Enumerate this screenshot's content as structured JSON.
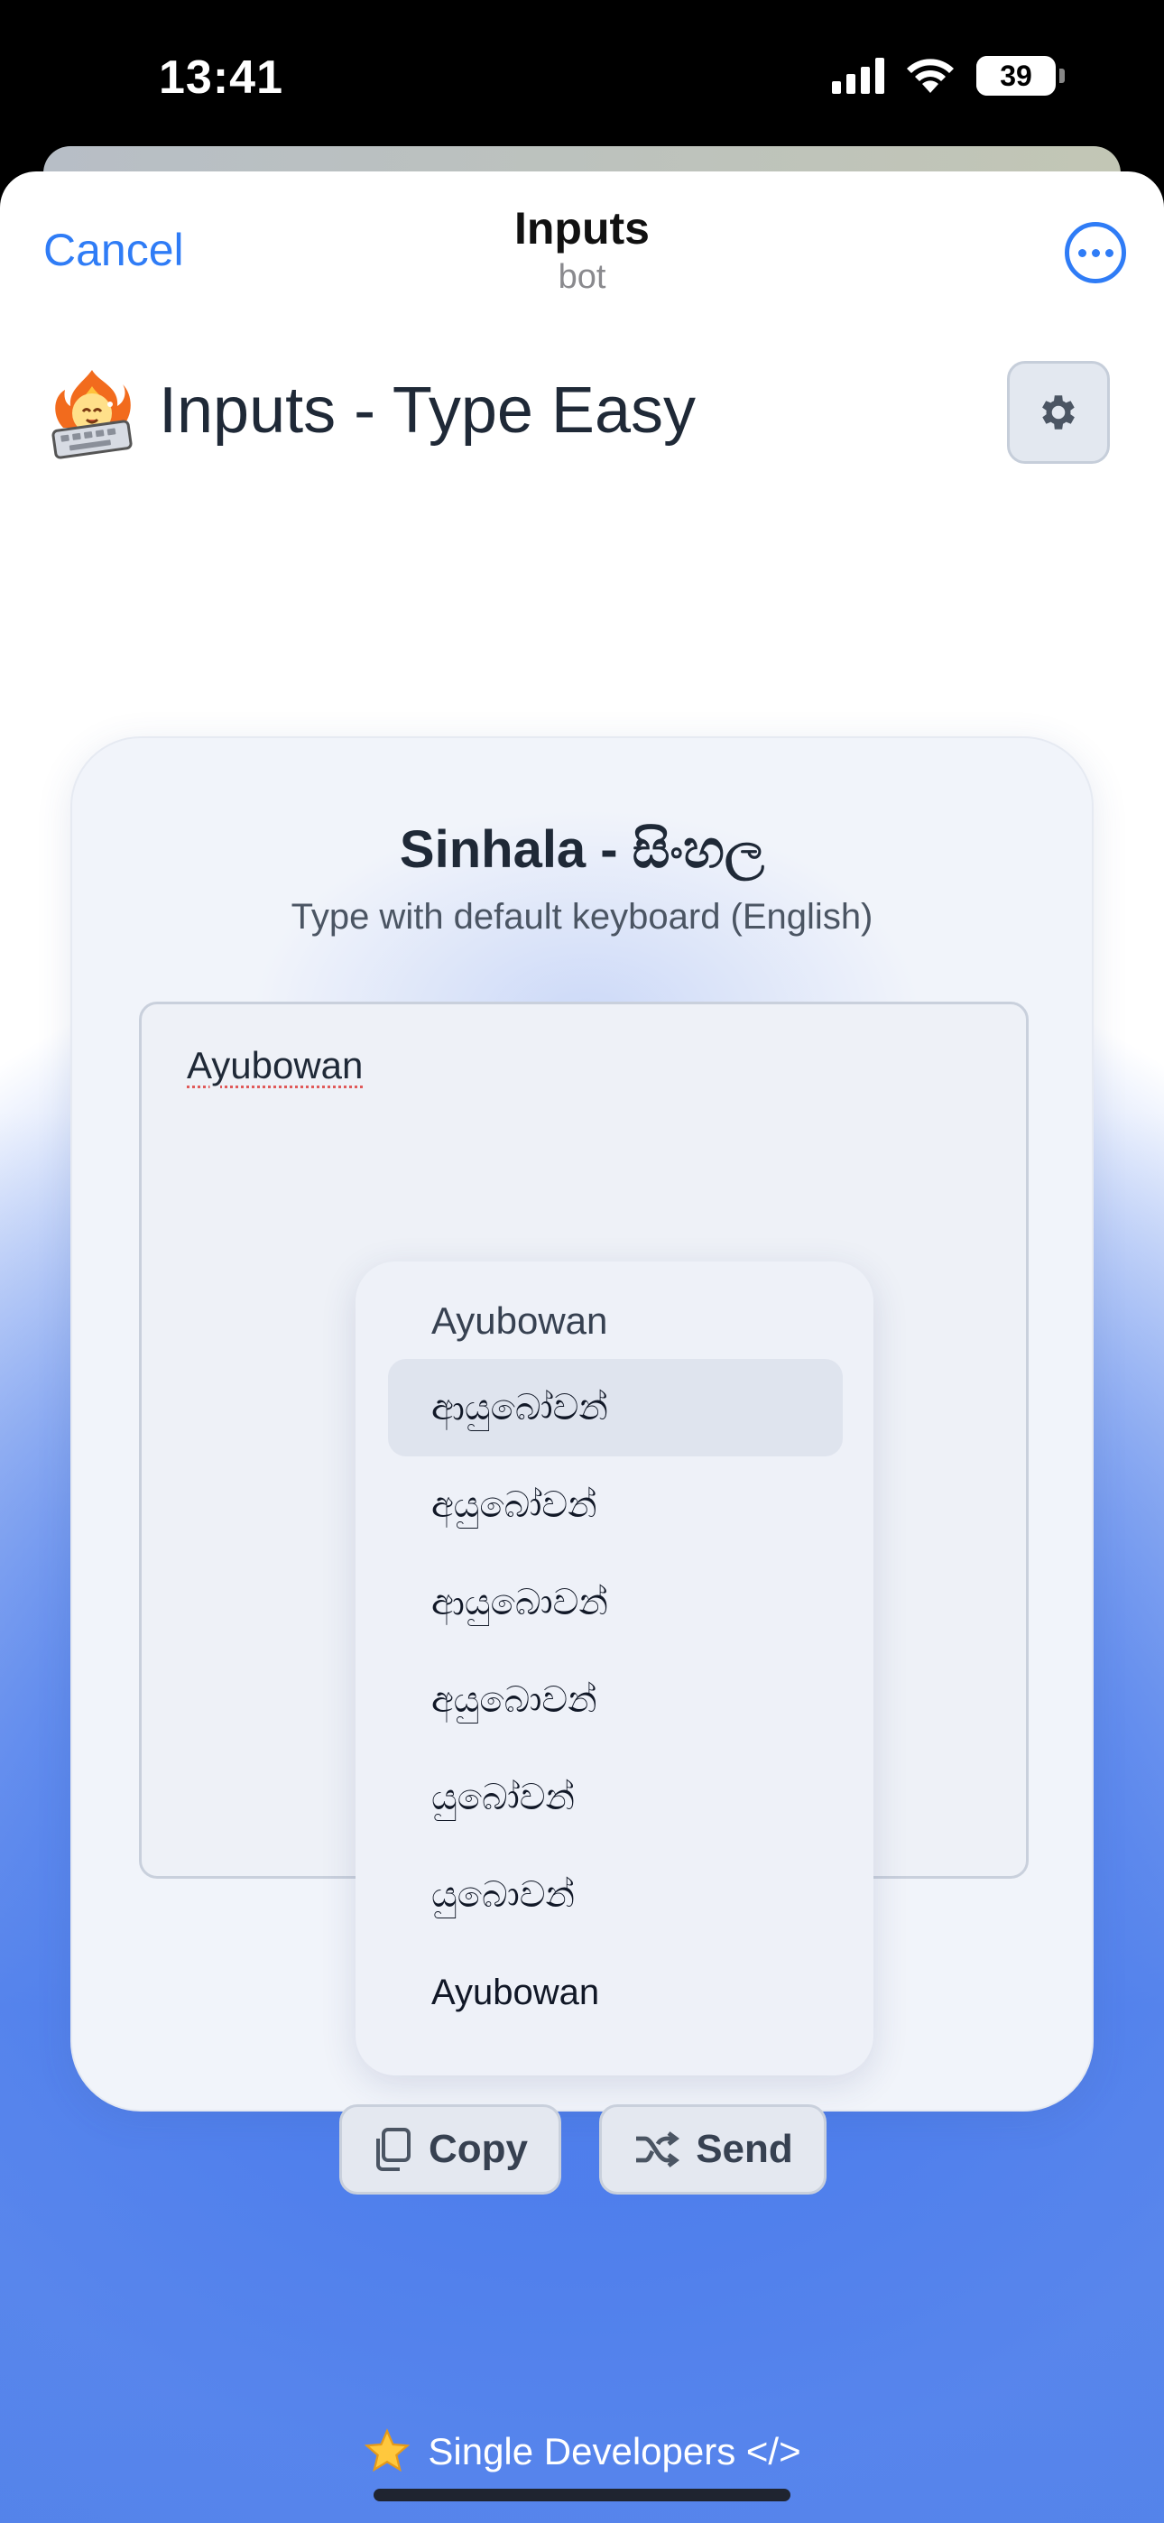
{
  "status": {
    "time": "13:41",
    "battery": "39",
    "battery_fraction": 0.39
  },
  "header": {
    "cancel_label": "Cancel",
    "title": "Inputs",
    "subtitle": "bot",
    "more_icon": "more-icon"
  },
  "app": {
    "title": "Inputs - Type Easy",
    "settings_icon": "gear-icon"
  },
  "card": {
    "title": "Sinhala - සිංහල",
    "subtitle": "Type with default keyboard (English)",
    "input_value": "Ayubowan",
    "suggestions": {
      "header": "Ayubowan",
      "items": [
        "ආයුබෝවන්",
        "අයුබෝවන්",
        "ආයුබොවන්",
        "අයුබොවන්",
        "යුබෝවන්",
        "යුබොවන්",
        "Ayubowan"
      ],
      "selected_index": 0
    },
    "copy_label": "Copy",
    "send_label": "Send"
  },
  "footer": {
    "text": "Single Developers </>",
    "icon": "star-icon"
  }
}
